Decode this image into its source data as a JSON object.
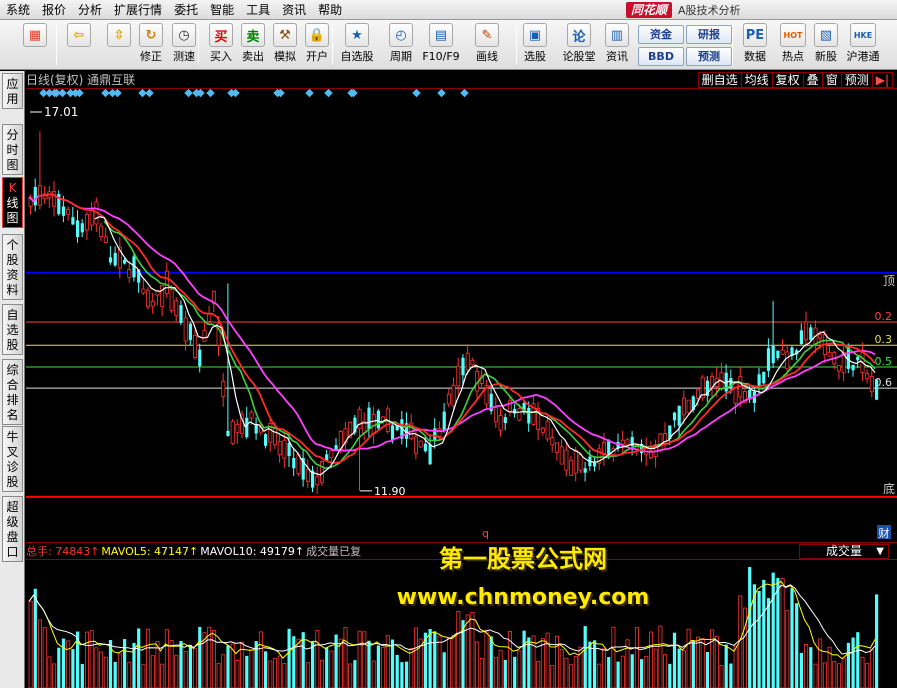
{
  "menu": [
    "系统",
    "报价",
    "分析",
    "扩展行情",
    "委托",
    "智能",
    "工具",
    "资讯",
    "帮助"
  ],
  "brand": {
    "logo": "同花顺",
    "subtitle": "A股技术分析"
  },
  "toolbar": {
    "buttons": [
      {
        "label": "",
        "icon": "window-grid-icon",
        "glyph": "▦",
        "color": "#e23c2c"
      },
      {
        "label": "",
        "icon": "back-arrow-icon",
        "glyph": "⇦",
        "color": "#e0a000"
      },
      {
        "label": "",
        "icon": "up-down-arrows-icon",
        "glyph": "⇳",
        "color": "#e0a000"
      },
      {
        "label": "修正",
        "icon": "refresh-icon",
        "glyph": "↻",
        "color": "#d08000"
      },
      {
        "label": "测速",
        "icon": "clock-icon",
        "glyph": "◷",
        "color": "#333333"
      },
      {
        "label": "买入",
        "icon": "buy-icon",
        "glyph": "买",
        "color": "#e00000"
      },
      {
        "label": "卖出",
        "icon": "sell-icon",
        "glyph": "卖",
        "color": "#008000"
      },
      {
        "label": "模拟",
        "icon": "hammer-icon",
        "glyph": "⚒",
        "color": "#8a4a10"
      },
      {
        "label": "开户",
        "icon": "lock-icon",
        "glyph": "🔒",
        "color": "#a06000"
      },
      {
        "label": "自选股",
        "icon": "star-folder-icon",
        "glyph": "★",
        "color": "#1a5fb4"
      },
      {
        "label": "周期",
        "icon": "period-clock-icon",
        "glyph": "◴",
        "color": "#1a5fb4"
      },
      {
        "label": "F10/F9",
        "icon": "f10-icon",
        "glyph": "▤",
        "color": "#1a5fb4"
      },
      {
        "label": "画线",
        "icon": "pencil-icon",
        "glyph": "✎",
        "color": "#c04000"
      },
      {
        "label": "选股",
        "icon": "monitor-icon",
        "glyph": "▣",
        "color": "#1a5fb4"
      },
      {
        "label": "论股堂",
        "icon": "lun-icon",
        "glyph": "论",
        "color": "#1a5fb4"
      },
      {
        "label": "资讯",
        "icon": "news-icon",
        "glyph": "▥",
        "color": "#1a5fb4"
      },
      {
        "label": "数据",
        "icon": "pe-icon",
        "glyph": "PE",
        "color": "#1a5fb4"
      },
      {
        "label": "热点",
        "icon": "hot-icon",
        "glyph": "HOT",
        "color": "#e06000"
      },
      {
        "label": "新股",
        "icon": "new-stock-icon",
        "glyph": "▧",
        "color": "#1a5fb4"
      },
      {
        "label": "沪港通",
        "icon": "hk-connect-icon",
        "glyph": "HKE",
        "color": "#1a5fb4"
      }
    ],
    "small_buttons": [
      "资金",
      "BBD",
      "研报",
      "预测"
    ]
  },
  "sidebar": [
    {
      "label": "应用"
    },
    {
      "label": "分时图"
    },
    {
      "label": "K线图",
      "active": true
    },
    {
      "label": "个股资料"
    },
    {
      "label": "自选股"
    },
    {
      "label": "综合排名"
    },
    {
      "label": "牛叉诊股"
    },
    {
      "label": "超级盘口"
    }
  ],
  "chart": {
    "title": "日线(复权) 通鼎互联",
    "toolbox": [
      "删自选",
      "均线",
      "复权",
      "叠",
      "窗",
      "预测",
      "▶|"
    ],
    "high_label": "17.01",
    "low_label": "11.90",
    "marker_q": "q",
    "right_labels": {
      "top": "顶",
      "bottom": "底",
      "fin": "财"
    },
    "fib_labels": [
      "0.2",
      "0.3",
      "0.5",
      "0.6"
    ]
  },
  "colors": {
    "up": "#ff3232",
    "down": "#54fcfc",
    "ma5": "#ffffff",
    "ma10": "#e8d020",
    "ma20": "#ff2a2a",
    "ma30": "#ff40ff",
    "ma60": "#3cd23c",
    "top_line": "#0000ff",
    "bottom_line": "#ff0000",
    "diamond": "#55b8f0"
  },
  "volume": {
    "legend": [
      {
        "text": "总手: 74843↑",
        "color": "#ff3232"
      },
      {
        "text": "MAVOL5: 47147↑",
        "color": "#ffff00"
      },
      {
        "text": "MAVOL10: 49179↑",
        "color": "#ffffff"
      },
      {
        "text": "成交量已复",
        "color": "#c0c0c0"
      }
    ],
    "selector": "成交量"
  },
  "watermark": {
    "title": "第一股票公式网",
    "url": "www.chnmoney.com"
  },
  "chart_data": {
    "type": "candlestick",
    "ylim": [
      11.5,
      17.3
    ],
    "top_level": 15.0,
    "bottom_level": 11.9,
    "fib_levels": [
      {
        "label": "0.2",
        "value": 14.3,
        "color": "#ff4040"
      },
      {
        "label": "0.3",
        "value": 13.97,
        "color": "#e0e040"
      },
      {
        "label": "0.5",
        "value": 13.66,
        "color": "#40e040"
      },
      {
        "label": "0.6",
        "value": 13.36,
        "color": "#e0e0e0"
      }
    ],
    "anchors": [
      [
        0,
        16.1
      ],
      [
        6,
        16.0
      ],
      [
        10,
        15.65
      ],
      [
        14,
        15.85
      ],
      [
        17,
        15.2
      ],
      [
        22,
        15.05
      ],
      [
        25,
        14.55
      ],
      [
        29,
        14.8
      ],
      [
        36,
        13.8
      ],
      [
        39,
        14.7
      ],
      [
        42,
        12.8
      ],
      [
        47,
        12.9
      ],
      [
        55,
        12.4
      ],
      [
        60,
        12.0
      ],
      [
        63,
        12.3
      ],
      [
        70,
        12.9
      ],
      [
        78,
        12.8
      ],
      [
        85,
        12.5
      ],
      [
        90,
        13.3
      ],
      [
        93,
        13.8
      ],
      [
        100,
        12.9
      ],
      [
        103,
        13.1
      ],
      [
        108,
        12.9
      ],
      [
        114,
        12.3
      ],
      [
        118,
        12.2
      ],
      [
        125,
        12.6
      ],
      [
        132,
        12.4
      ],
      [
        137,
        12.9
      ],
      [
        142,
        13.3
      ],
      [
        148,
        13.45
      ],
      [
        154,
        13.25
      ],
      [
        158,
        13.9
      ],
      [
        162,
        13.8
      ],
      [
        166,
        14.2
      ],
      [
        172,
        13.7
      ],
      [
        176,
        13.75
      ],
      [
        180,
        13.3
      ]
    ],
    "diamonds": [
      18,
      24,
      29,
      31,
      37,
      45,
      50,
      54,
      80,
      87,
      92,
      117,
      124,
      163,
      171,
      175,
      185,
      206,
      210,
      252,
      255,
      284,
      303,
      326,
      328,
      391,
      416,
      439
    ],
    "volume_ylim": [
      0,
      100000
    ]
  }
}
